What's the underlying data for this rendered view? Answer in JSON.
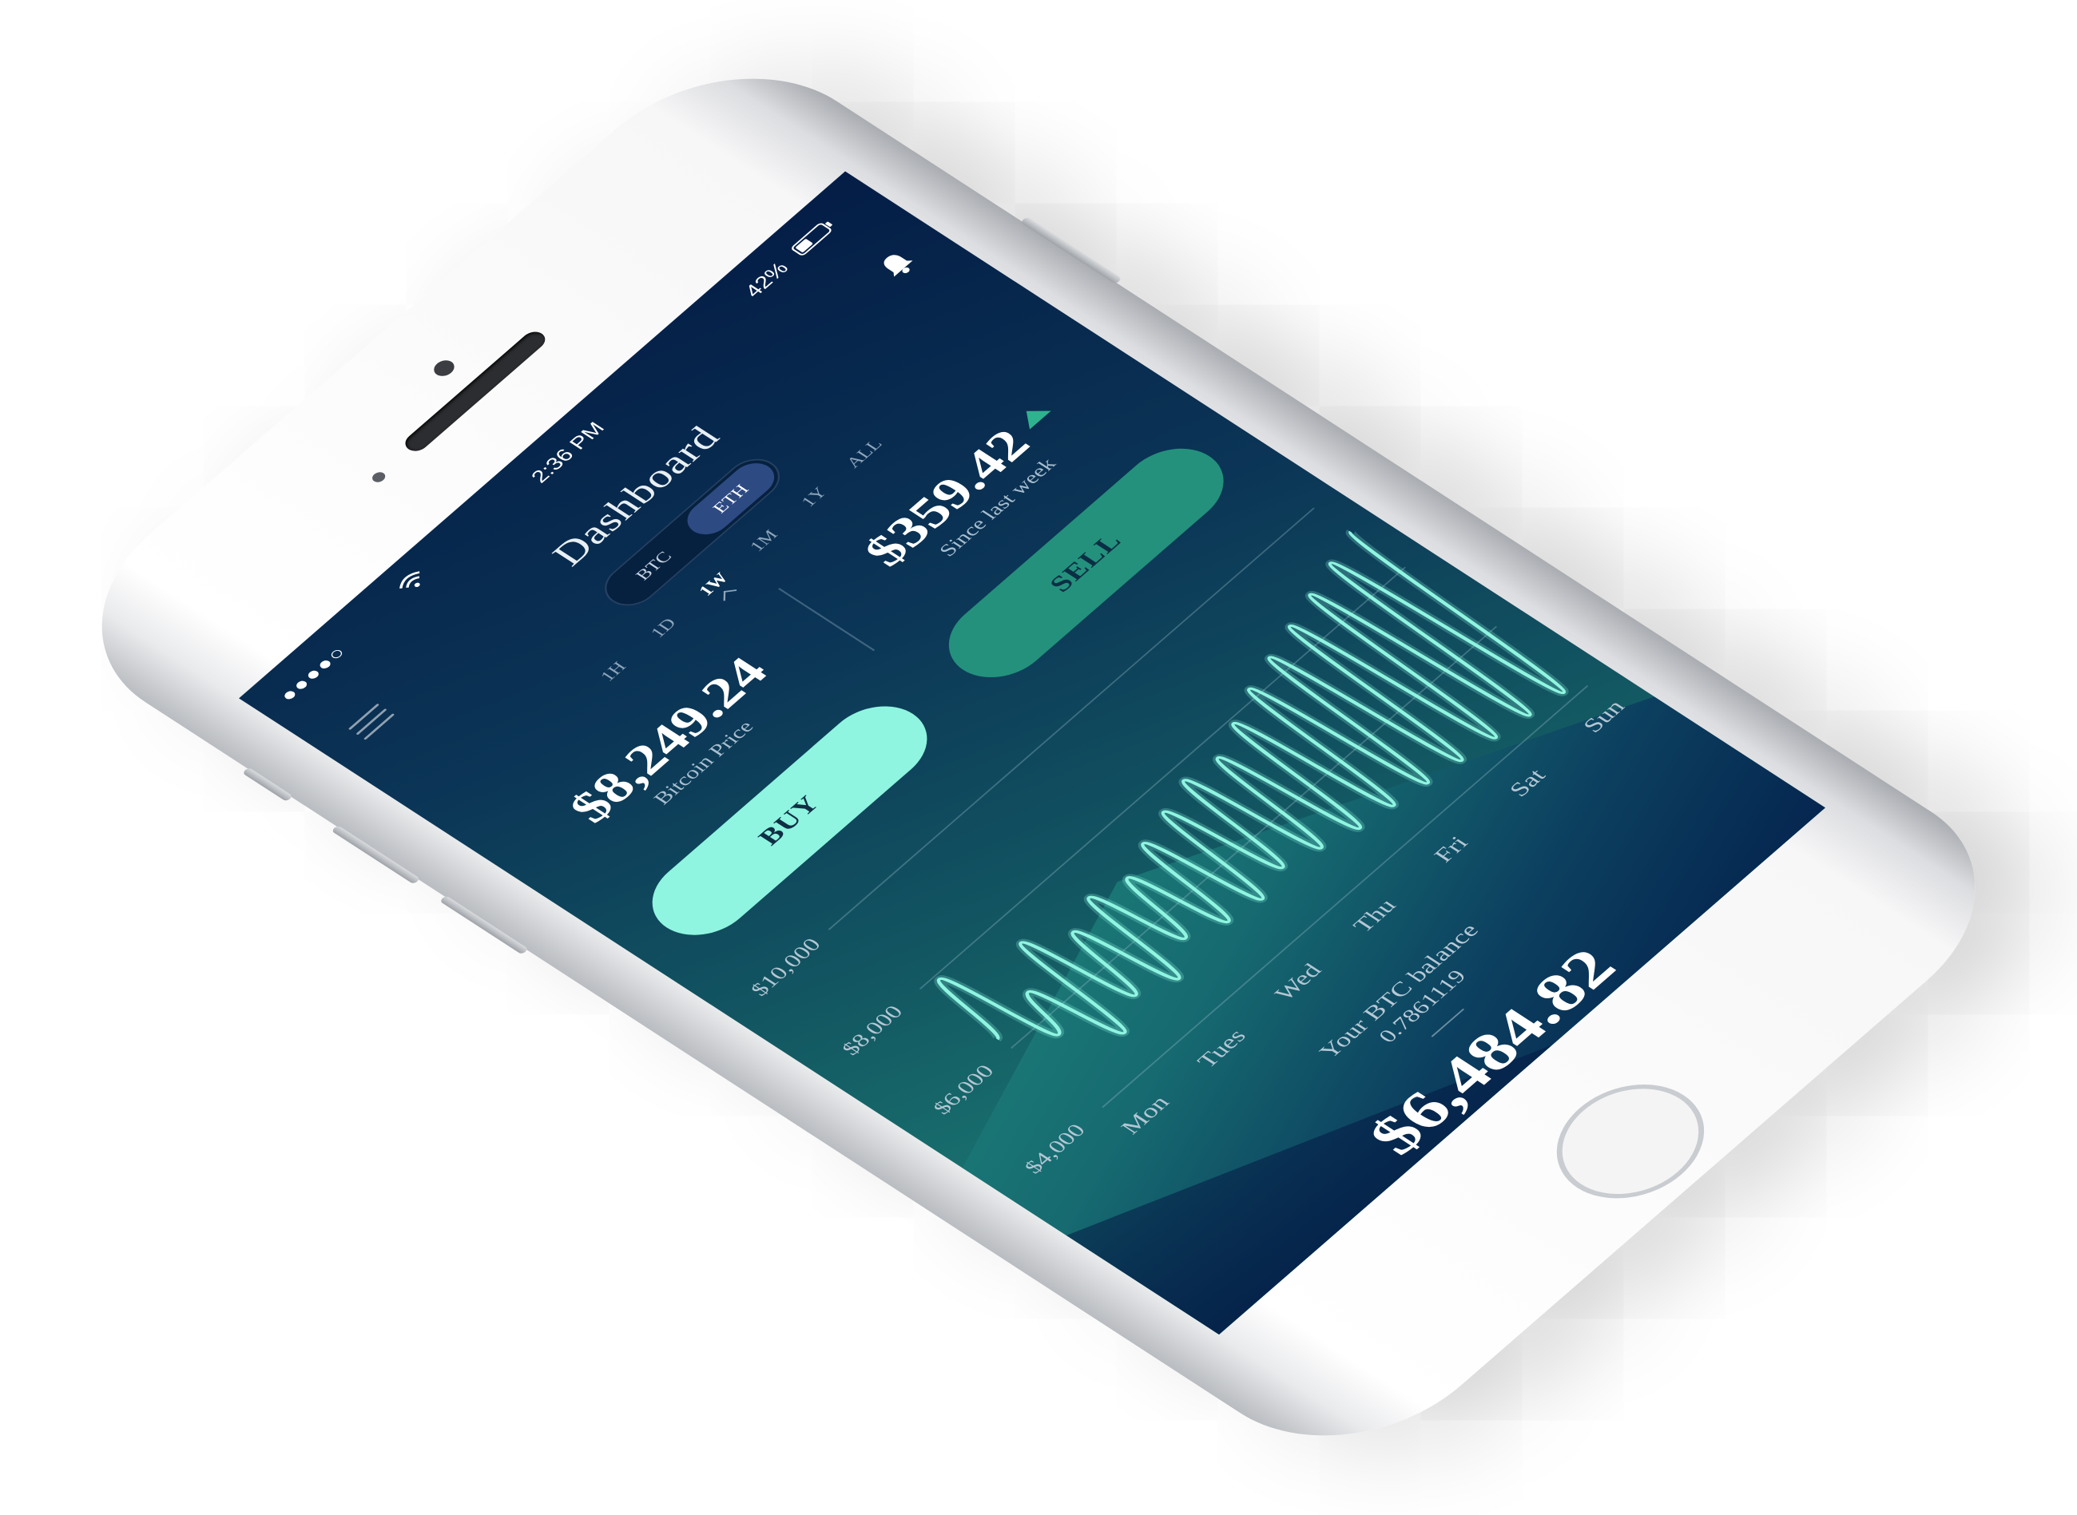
{
  "status_bar": {
    "signal": "●●●●○",
    "time": "2:36 PM",
    "battery": "42%"
  },
  "icons": [
    "menu-icon",
    "wifi-icon",
    "bell-icon",
    "battery-icon",
    "up-arrow-icon"
  ],
  "header": {
    "title": "Dashboard"
  },
  "coin_toggle": {
    "options": [
      "BTC",
      "ETH"
    ],
    "selected": "ETH"
  },
  "range_tabs": {
    "options": [
      "1H",
      "1D",
      "1W",
      "1M",
      "1Y",
      "ALL"
    ],
    "selected": "1W"
  },
  "bitcoin_price": {
    "value": "$8,249.24",
    "label": "Bitcoin Price"
  },
  "weekly_change": {
    "value": "$359.42",
    "label": "Since last week",
    "direction": "up"
  },
  "actions": {
    "buy": "BUY",
    "sell": "SELL"
  },
  "colors": {
    "accent": "#8ff5e0",
    "sell": "#24917c",
    "background_top": "#041d46",
    "background_bottom": "#1f8a7a",
    "line": "#8ff5e0"
  },
  "chart_data": {
    "type": "line",
    "categories": [
      "Mon",
      "Tues",
      "Wed",
      "Thu",
      "Fri",
      "Sat",
      "Sun"
    ],
    "y_tick_labels": [
      "$10,000",
      "$8,000",
      "$6,000",
      "$4,000"
    ],
    "ylim": [
      4000,
      10000
    ],
    "grid": true,
    "y_values": [
      6300,
      7900,
      5600,
      6600,
      4800,
      7400,
      5200,
      6900,
      4900,
      7200,
      5400,
      7000,
      5100,
      7300,
      5000,
      7500,
      5200,
      7700,
      5000,
      7600,
      4800,
      7900,
      4700,
      8200,
      4600,
      8400,
      4500,
      8600,
      4400,
      8800,
      4300,
      9000,
      4200,
      9200
    ]
  },
  "balance": {
    "label": "Your BTC balance",
    "btc": "0.7861119",
    "usd": "$6,484.82"
  }
}
